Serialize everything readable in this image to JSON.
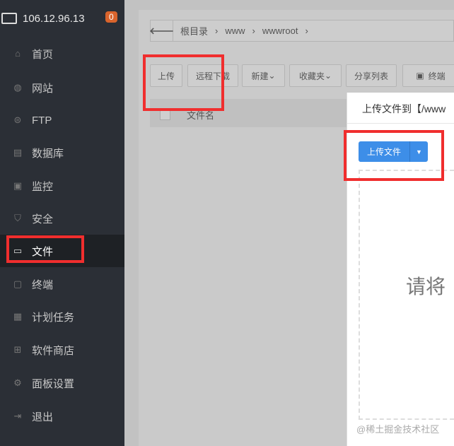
{
  "sidebar": {
    "server_ip": "106.12.96.13",
    "badge": "0",
    "items": [
      {
        "label": "首页",
        "icon": "home-icon"
      },
      {
        "label": "网站",
        "icon": "globe-icon"
      },
      {
        "label": "FTP",
        "icon": "ftp-icon"
      },
      {
        "label": "数据库",
        "icon": "database-icon"
      },
      {
        "label": "监控",
        "icon": "monitor-icon"
      },
      {
        "label": "安全",
        "icon": "shield-icon"
      },
      {
        "label": "文件",
        "icon": "folder-icon"
      },
      {
        "label": "终端",
        "icon": "terminal-icon"
      },
      {
        "label": "计划任务",
        "icon": "calendar-icon"
      },
      {
        "label": "软件商店",
        "icon": "apps-icon"
      },
      {
        "label": "面板设置",
        "icon": "gear-icon"
      },
      {
        "label": "退出",
        "icon": "logout-icon"
      }
    ],
    "active": "文件"
  },
  "breadcrumb": [
    "根目录",
    "www",
    "wwwroot"
  ],
  "toolbar": {
    "upload": "上传",
    "remote_download": "远程下载",
    "new": "新建",
    "favorites": "收藏夹",
    "share_list": "分享列表",
    "terminal": "终端"
  },
  "table": {
    "col_filename": "文件名"
  },
  "modal": {
    "title": "上传文件到【/www",
    "upload_button": "上传文件",
    "drop_hint": "请将"
  },
  "watermark": "@稀土掘金技术社区",
  "colors": {
    "highlight": "#f02e2e",
    "primary": "#3d8ee8",
    "badge": "#d9642c"
  }
}
